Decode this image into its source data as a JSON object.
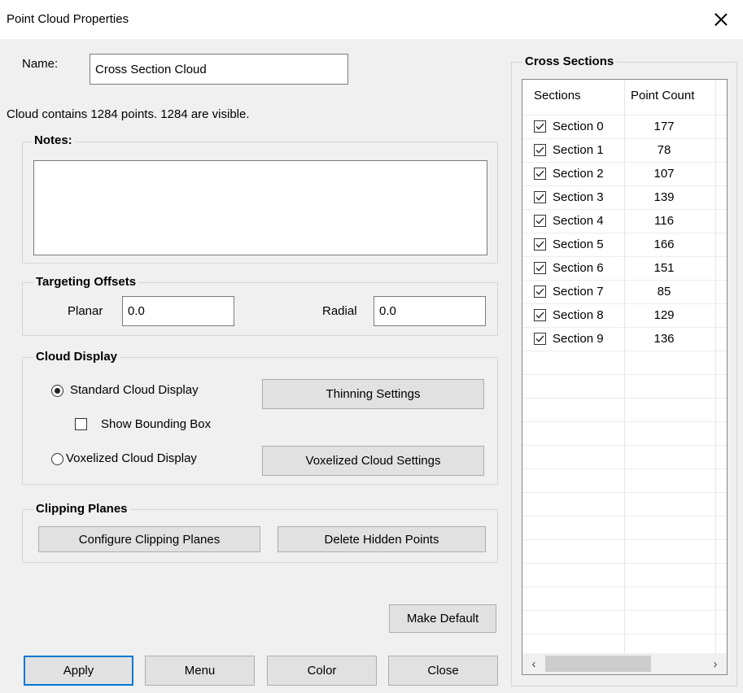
{
  "window": {
    "title": "Point Cloud Properties"
  },
  "name_field": {
    "label": "Name:",
    "value": "Cross Section Cloud"
  },
  "cloud_info": "Cloud contains 1284 points.  1284 are visible.",
  "notes": {
    "title": "Notes:",
    "value": ""
  },
  "targeting": {
    "title": "Targeting Offsets",
    "planar_label": "Planar",
    "planar_value": "0.0",
    "radial_label": "Radial",
    "radial_value": "0.0"
  },
  "cloud_display": {
    "title": "Cloud Display",
    "standard_label": "Standard Cloud Display",
    "standard_selected": true,
    "bounding_box_label": "Show Bounding Box",
    "bounding_box_checked": false,
    "voxelized_label": "Voxelized Cloud Display",
    "voxelized_selected": false,
    "thinning_button": "Thinning Settings",
    "voxel_button": "Voxelized Cloud Settings"
  },
  "clipping": {
    "title": "Clipping Planes",
    "configure_button": "Configure Clipping Planes",
    "delete_button": "Delete Hidden Points"
  },
  "make_default_button": "Make Default",
  "bottom_buttons": {
    "apply": "Apply",
    "menu": "Menu",
    "color": "Color",
    "close": "Close"
  },
  "cross_sections": {
    "title": "Cross Sections",
    "columns": [
      "Sections",
      "Point Count"
    ],
    "rows": [
      {
        "name": "Section 0",
        "count": "177",
        "checked": true
      },
      {
        "name": "Section 1",
        "count": "78",
        "checked": true
      },
      {
        "name": "Section 2",
        "count": "107",
        "checked": true
      },
      {
        "name": "Section 3",
        "count": "139",
        "checked": true
      },
      {
        "name": "Section 4",
        "count": "116",
        "checked": true
      },
      {
        "name": "Section 5",
        "count": "166",
        "checked": true
      },
      {
        "name": "Section 6",
        "count": "151",
        "checked": true
      },
      {
        "name": "Section 7",
        "count": "85",
        "checked": true
      },
      {
        "name": "Section 8",
        "count": "129",
        "checked": true
      },
      {
        "name": "Section 9",
        "count": "136",
        "checked": true
      }
    ]
  },
  "colors": {
    "accent": "#0078d7",
    "button_bg": "#e1e1e1",
    "window_bg": "#f0f0f0"
  }
}
